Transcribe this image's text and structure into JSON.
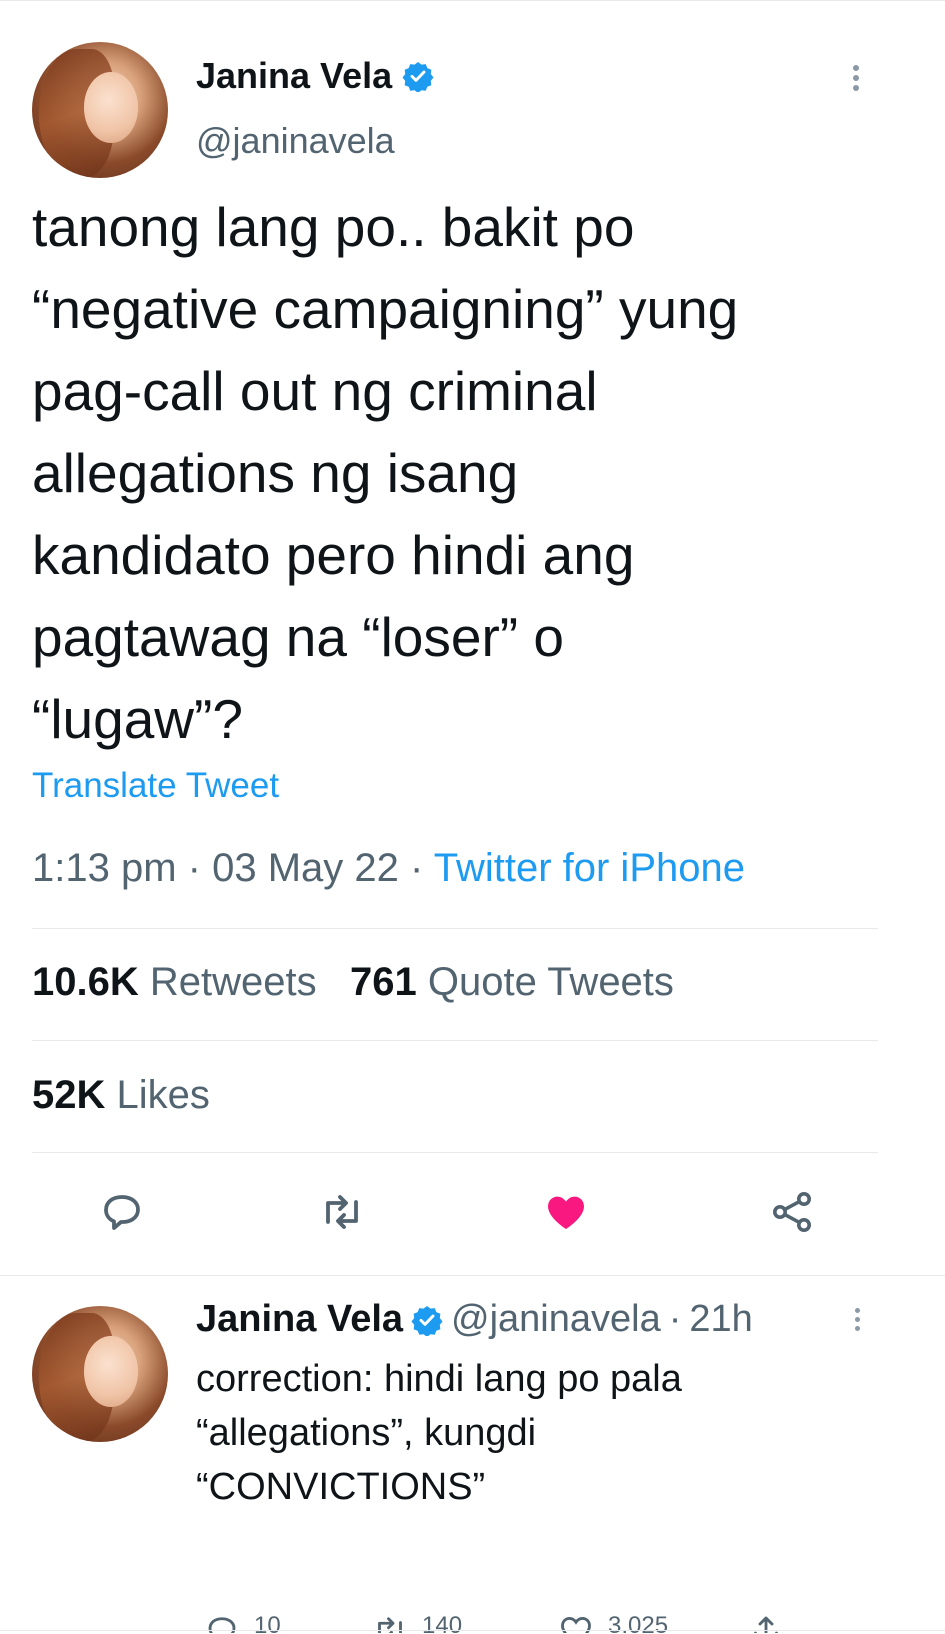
{
  "main_tweet": {
    "author_name": "Janina Vela",
    "handle": "@janinavela",
    "verified": true,
    "text": "tanong lang po.. bakit po\n“negative campaigning” yung\npag-call out ng criminal\nallegations ng isang\nkandidato pero hindi ang\npagtawag na “loser” o\n“lugaw”?",
    "translate_label": "Translate Tweet",
    "time": "1:13 pm",
    "date": "03 May 22",
    "source": "Twitter for iPhone",
    "separator": "·",
    "retweets_count": "10.6K",
    "retweets_label": "Retweets",
    "quotes_count": "761",
    "quotes_label": "Quote Tweets",
    "likes_count": "52K",
    "likes_label": "Likes",
    "actions": [
      "reply-icon",
      "retweet-icon",
      "like-icon",
      "share-icon"
    ],
    "liked": true
  },
  "reply_tweet": {
    "author_name": "Janina Vela",
    "handle": "@janinavela",
    "separator": "·",
    "age": "21h",
    "verified": true,
    "text": "correction: hindi lang po pala\n“allegations”, kungdi\n“CONVICTIONS”",
    "action_counts": [
      "10",
      "140",
      "3,025"
    ]
  },
  "colors": {
    "accent": "#1d9bf0",
    "like": "#f91880",
    "text_primary": "#0f1419",
    "text_secondary": "#536471",
    "divider": "#e7e9ea"
  }
}
